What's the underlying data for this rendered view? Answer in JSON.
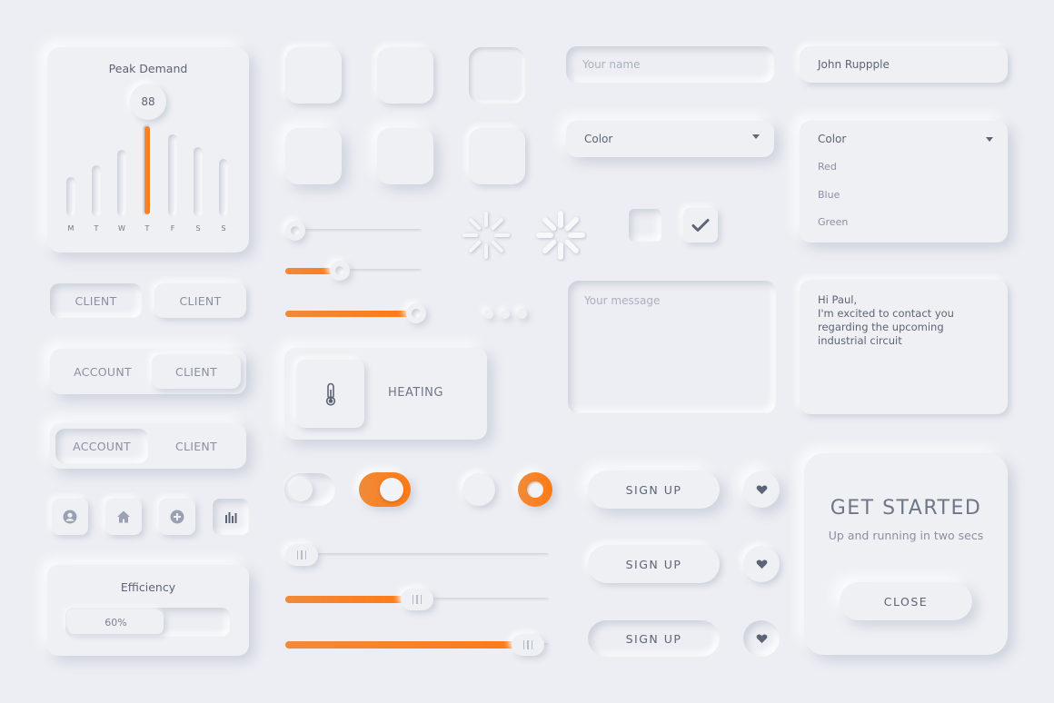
{
  "peak_demand": {
    "title": "Peak Demand",
    "value": "88",
    "days": [
      "M",
      "T",
      "W",
      "T",
      "F",
      "S",
      "S"
    ],
    "levels": [
      0.38,
      0.5,
      0.65,
      0.9,
      0.8,
      0.68,
      0.56
    ],
    "highlight_index": 3
  },
  "segmented": {
    "row1": [
      "CLIENT",
      "CLIENT"
    ],
    "row2": [
      "ACCOUNT",
      "CLIENT"
    ],
    "row3": [
      "ACCOUNT",
      "CLIENT"
    ]
  },
  "icon_buttons": [
    "user-icon",
    "home-icon",
    "plus-icon",
    "chart-icon"
  ],
  "efficiency": {
    "title": "Efficiency",
    "value_label": "60%",
    "fraction": 0.6
  },
  "sliders_top": [
    0.0,
    0.35,
    0.95
  ],
  "heating": {
    "label": "HEATING",
    "icon": "thermometer-icon"
  },
  "toggles": {
    "switch_off": false,
    "switch_on": true,
    "radio_off": false,
    "radio_on": true
  },
  "sliders_bottom": [
    0.0,
    0.5,
    0.98
  ],
  "inputs": {
    "name_placeholder": "Your name",
    "name_value": "John Ruppple",
    "color_select_label": "Color",
    "color_dropdown_label": "Color",
    "color_options": [
      "Red",
      "Blue",
      "Green"
    ],
    "message_placeholder": "Your message",
    "message_value": "Hi Paul,\nI'm excited to contact you regarding the upcoming industrial circuit"
  },
  "checkbox_checked": true,
  "buttons": {
    "signup": [
      "SIGN UP",
      "SIGN UP",
      "SIGN UP"
    ]
  },
  "get_started": {
    "title": "GET STARTED",
    "subtitle": "Up and running in two secs",
    "close_label": "CLOSE"
  },
  "colors": {
    "accent": "#ff7a14",
    "background": "#eceef3",
    "text": "#6f7688"
  }
}
